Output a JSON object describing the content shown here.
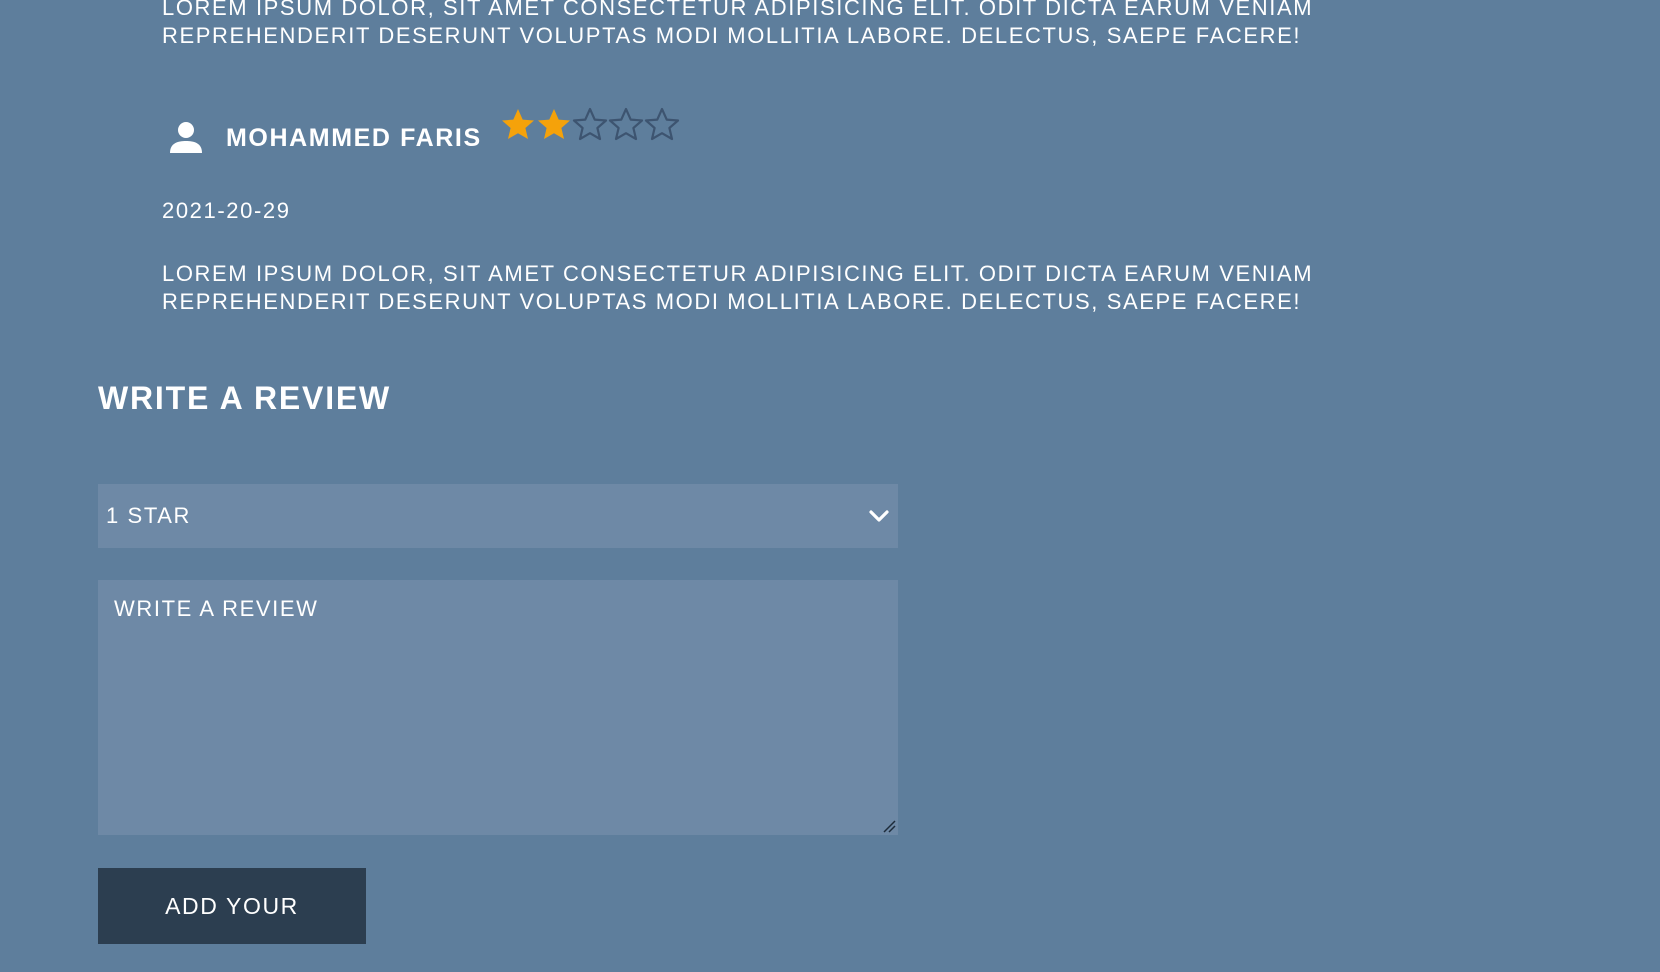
{
  "previous_review": {
    "text_line1": "LOREM IPSUM DOLOR, SIT AMET CONSECTETUR ADIPISICING ELIT. ODIT DICTA EARUM VENIAM",
    "text_line2": "REPREHENDERIT DESERUNT VOLUPTAS MODI MOLLITIA LABORE. DELECTUS, SAEPE FACERE!"
  },
  "review": {
    "reviewer_name": "MOHAMMED FARIS",
    "rating": 2,
    "max_rating": 5,
    "date": "2021-20-29",
    "text_line1": "LOREM IPSUM DOLOR, SIT AMET CONSECTETUR ADIPISICING ELIT. ODIT DICTA EARUM VENIAM",
    "text_line2": "REPREHENDERIT DESERUNT VOLUPTAS MODI MOLLITIA LABORE. DELECTUS, SAEPE FACERE!"
  },
  "write_review": {
    "title": "WRITE A REVIEW",
    "rating_select_value": "1 STAR",
    "textarea_placeholder": "WRITE A REVIEW",
    "submit_label": "ADD YOUR"
  },
  "colors": {
    "background": "#5e7e9c",
    "input_background": "#6e89a6",
    "button_background": "#2c3e50",
    "star_filled": "#f5a20a",
    "star_empty_outline": "#3d5470",
    "text": "#ffffff"
  },
  "icons": {
    "user": "user-icon",
    "star_filled": "star-filled-icon",
    "star_empty": "star-empty-icon",
    "select_arrow": "chevron-down-icon"
  }
}
